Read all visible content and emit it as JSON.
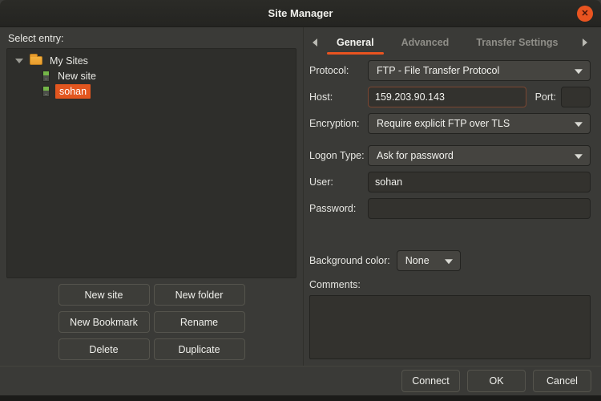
{
  "window": {
    "title": "Site Manager"
  },
  "icons": {
    "close": "✕",
    "dropdown_arrow": "chevron-down",
    "tree_expander": "chevron-down",
    "tab_scroll_left": "chevron-left",
    "tab_scroll_right": "chevron-right",
    "folder": "folder",
    "site": "server"
  },
  "colors": {
    "accent": "#E95420",
    "selected_item_bg": "#E2561F",
    "folder_icon": "#F0A63C",
    "server_icon_green": "#74B648",
    "host_focus_border": "#7A4631",
    "titlebar_bg": "#262622",
    "dialog_bg": "#3A3A37",
    "tree_bg": "#2E2E2B"
  },
  "left_panel": {
    "select_entry_label": "Select entry:",
    "tree": {
      "root": {
        "label": "My Sites"
      },
      "items": [
        {
          "label": "New site",
          "selected": false
        },
        {
          "label": "sohan",
          "selected": true
        }
      ]
    },
    "buttons": [
      "New site",
      "New folder",
      "New Bookmark",
      "Rename",
      "Delete",
      "Duplicate"
    ]
  },
  "tabs": {
    "items": [
      "General",
      "Advanced",
      "Transfer Settings"
    ],
    "active": "General"
  },
  "form": {
    "protocol": {
      "label": "Protocol:",
      "value": "FTP - File Transfer Protocol"
    },
    "host": {
      "label": "Host:",
      "value": "159.203.90.143"
    },
    "port": {
      "label": "Port:",
      "value": ""
    },
    "encryption": {
      "label": "Encryption:",
      "value": "Require explicit FTP over TLS"
    },
    "logon_type": {
      "label": "Logon Type:",
      "value": "Ask for password"
    },
    "user": {
      "label": "User:",
      "value": "sohan"
    },
    "password": {
      "label": "Password:",
      "value": ""
    },
    "background_color": {
      "label": "Background color:",
      "value": "None"
    },
    "comments": {
      "label": "Comments:",
      "value": ""
    }
  },
  "footer": {
    "buttons": [
      "Connect",
      "OK",
      "Cancel"
    ]
  }
}
